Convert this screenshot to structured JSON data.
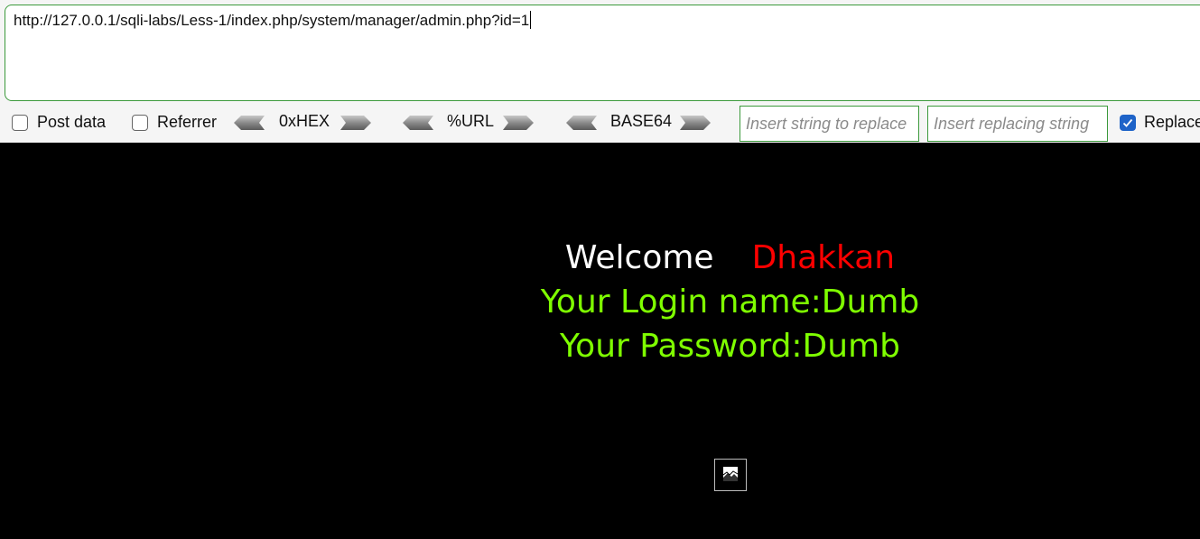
{
  "url_bar": {
    "value": "http://127.0.0.1/sqli-labs/Less-1/index.php/system/manager/admin.php?id=1"
  },
  "options": {
    "post_data": {
      "label": "Post data",
      "checked": false
    },
    "referrer": {
      "label": "Referrer",
      "checked": false
    },
    "replace": {
      "label": "Replace",
      "checked": true
    }
  },
  "encoders": [
    {
      "label": "0xHEX"
    },
    {
      "label": "%URL"
    },
    {
      "label": "BASE64"
    }
  ],
  "replace_inputs": {
    "find_placeholder": "Insert string to replace",
    "replace_placeholder": "Insert replacing string"
  },
  "page": {
    "welcome": "Welcome",
    "user": "Dhakkan",
    "login_line": "Your Login name:Dumb",
    "password_line": "Your Password:Dumb"
  },
  "colors": {
    "accent_border": "#3c9a3c",
    "checkbox_checked": "#1e63c8",
    "welcome_text": "#ffffff",
    "user_text": "#ff0000",
    "result_text": "#7fff00",
    "page_background": "#000000"
  }
}
